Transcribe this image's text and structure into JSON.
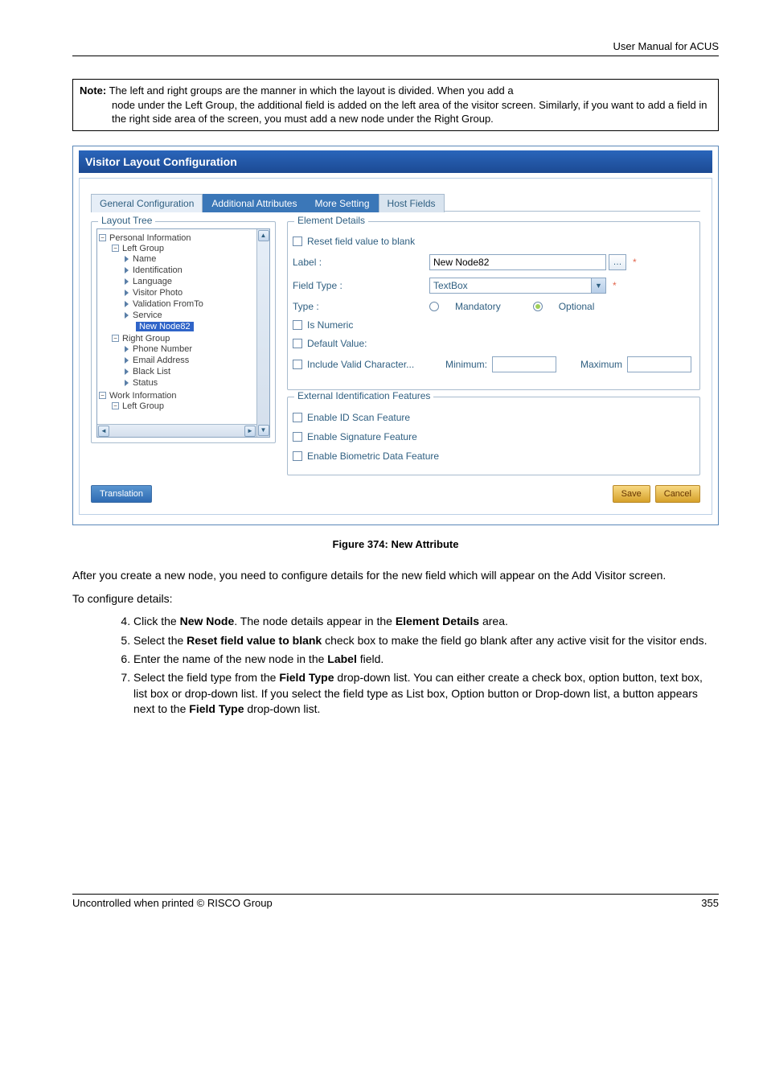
{
  "header": {
    "right_text": "User Manual for ACUS"
  },
  "note": {
    "label": "Note:",
    "text": " The left and right groups are the manner in which the layout is divided. When you add a node under the Left Group, the additional field is added on the left area of the visitor screen. Similarly, if you want to add a field in the right side area of the screen, you must add a new node under the Right Group."
  },
  "vlc": {
    "title": "Visitor Layout Configuration",
    "tabs": {
      "general": "General Configuration",
      "additional": "Additional Attributes",
      "more": "More Setting",
      "host": "Host Fields"
    },
    "layout_tree": {
      "legend": "Layout Tree",
      "nodes": {
        "personal_info": "Personal Information",
        "left_group": "Left Group",
        "name": "Name",
        "identification": "Identification",
        "language": "Language",
        "visitor_photo": "Visitor Photo",
        "validation_fromto": "Validation FromTo",
        "service": "Service",
        "new_node82": "New Node82",
        "right_group": "Right Group",
        "phone_number": "Phone Number",
        "email_address": "Email Address",
        "black_list": "Black List",
        "status": "Status",
        "work_information": "Work Information",
        "left_group2": "Left Group"
      }
    },
    "element_details": {
      "legend": "Element Details",
      "reset_label": "Reset field value to blank",
      "label_label": "Label :",
      "label_value": "New Node82",
      "fieldtype_label": "Field Type :",
      "fieldtype_value": "TextBox",
      "type_label": "Type :",
      "mandatory": "Mandatory",
      "optional": "Optional",
      "isnumeric": "Is Numeric",
      "defaultvalue": "Default Value:",
      "includevalid": "Include Valid Character...",
      "minimum": "Minimum:",
      "maximum": "Maximum"
    },
    "ext": {
      "legend": "External Identification Features",
      "idscan": "Enable ID Scan Feature",
      "signature": "Enable Signature Feature",
      "biometric": "Enable Biometric Data Feature"
    },
    "buttons": {
      "translation": "Translation",
      "save": "Save",
      "cancel": "Cancel"
    }
  },
  "figure_caption": "Figure 374: New Attribute",
  "body": {
    "para1": "After you create a new node, you need to configure details for the new field which will appear on the Add Visitor screen.",
    "para2": "To configure details:",
    "steps": {
      "s4": "Click the New Node. The node details appear in the Element Details area.",
      "s4_bold1": "New Node",
      "s4_bold2": "Element Details",
      "s5_pre": "Select the ",
      "s5_bold": "Reset field value to blank",
      "s5_post": " check box to make the field go blank after any active visit for the visitor ends.",
      "s6_pre": "Enter the name of the new node in the ",
      "s6_bold": "Label",
      "s6_post": " field.",
      "s7_pre": "Select the field type from the ",
      "s7_bold1": "Field Type",
      "s7_mid": " drop-down list. You can either create a check box, option button, text box, list box or drop-down list. If you select the field type as List box, Option button or Drop-down list, a button appears next to the ",
      "s7_bold2": "Field Type",
      "s7_post": " drop-down list."
    }
  },
  "footer": {
    "left": "Uncontrolled when printed © RISCO Group",
    "right": "355"
  }
}
